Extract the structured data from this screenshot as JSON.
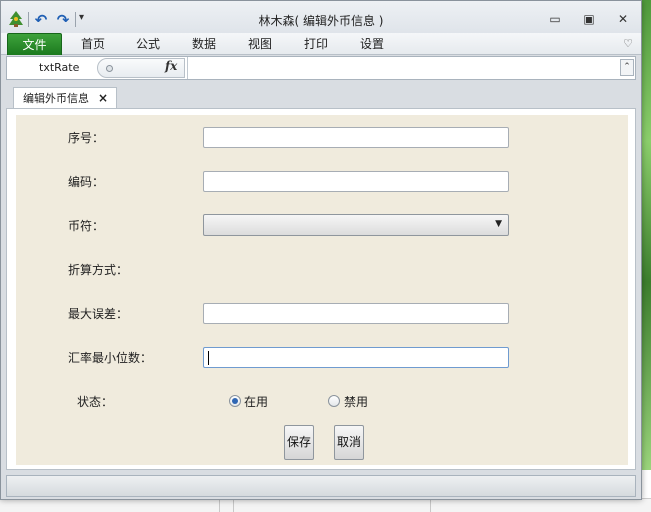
{
  "window": {
    "title": "林木森( 编辑外币信息 )",
    "minimize": "▭",
    "restore": "▣",
    "close": "✕"
  },
  "quick_access": {
    "undo_glyph": "↶",
    "redo_glyph": "↷",
    "more_glyph": "▾"
  },
  "ribbon": {
    "tabs": [
      "文件",
      "首页",
      "公式",
      "数据",
      "视图",
      "打印",
      "设置"
    ],
    "collapse_glyph": "♡"
  },
  "formula_bar": {
    "name_box": "txtRate",
    "fx": "fx",
    "expand_glyph": "⌃"
  },
  "document_tab": {
    "label": "编辑外币信息",
    "close": "×"
  },
  "form": {
    "fields": {
      "seq_label": "序号：",
      "code_label": "编码：",
      "symbol_label": "币符：",
      "conversion_label": "折算方式：",
      "max_error_label": "最大误差：",
      "rate_decimals_label": "汇率最小位数："
    },
    "values": {
      "seq": "",
      "code": "",
      "symbol": "",
      "max_error": "",
      "rate_decimals": ""
    },
    "status": {
      "label": "状态：",
      "options": [
        "在用",
        "禁用"
      ],
      "selected": "在用"
    },
    "buttons": {
      "save": "保存",
      "cancel": "取消"
    }
  },
  "icons": {
    "app_logo": "app-logo-icon",
    "undo": "undo-icon",
    "redo": "redo-icon",
    "dropdown": "dropdown-arrow-icon"
  },
  "colors": {
    "file_tab": "#2b8f2d",
    "form_background": "#f0ebdd",
    "radio_selected": "#2f66b3"
  }
}
